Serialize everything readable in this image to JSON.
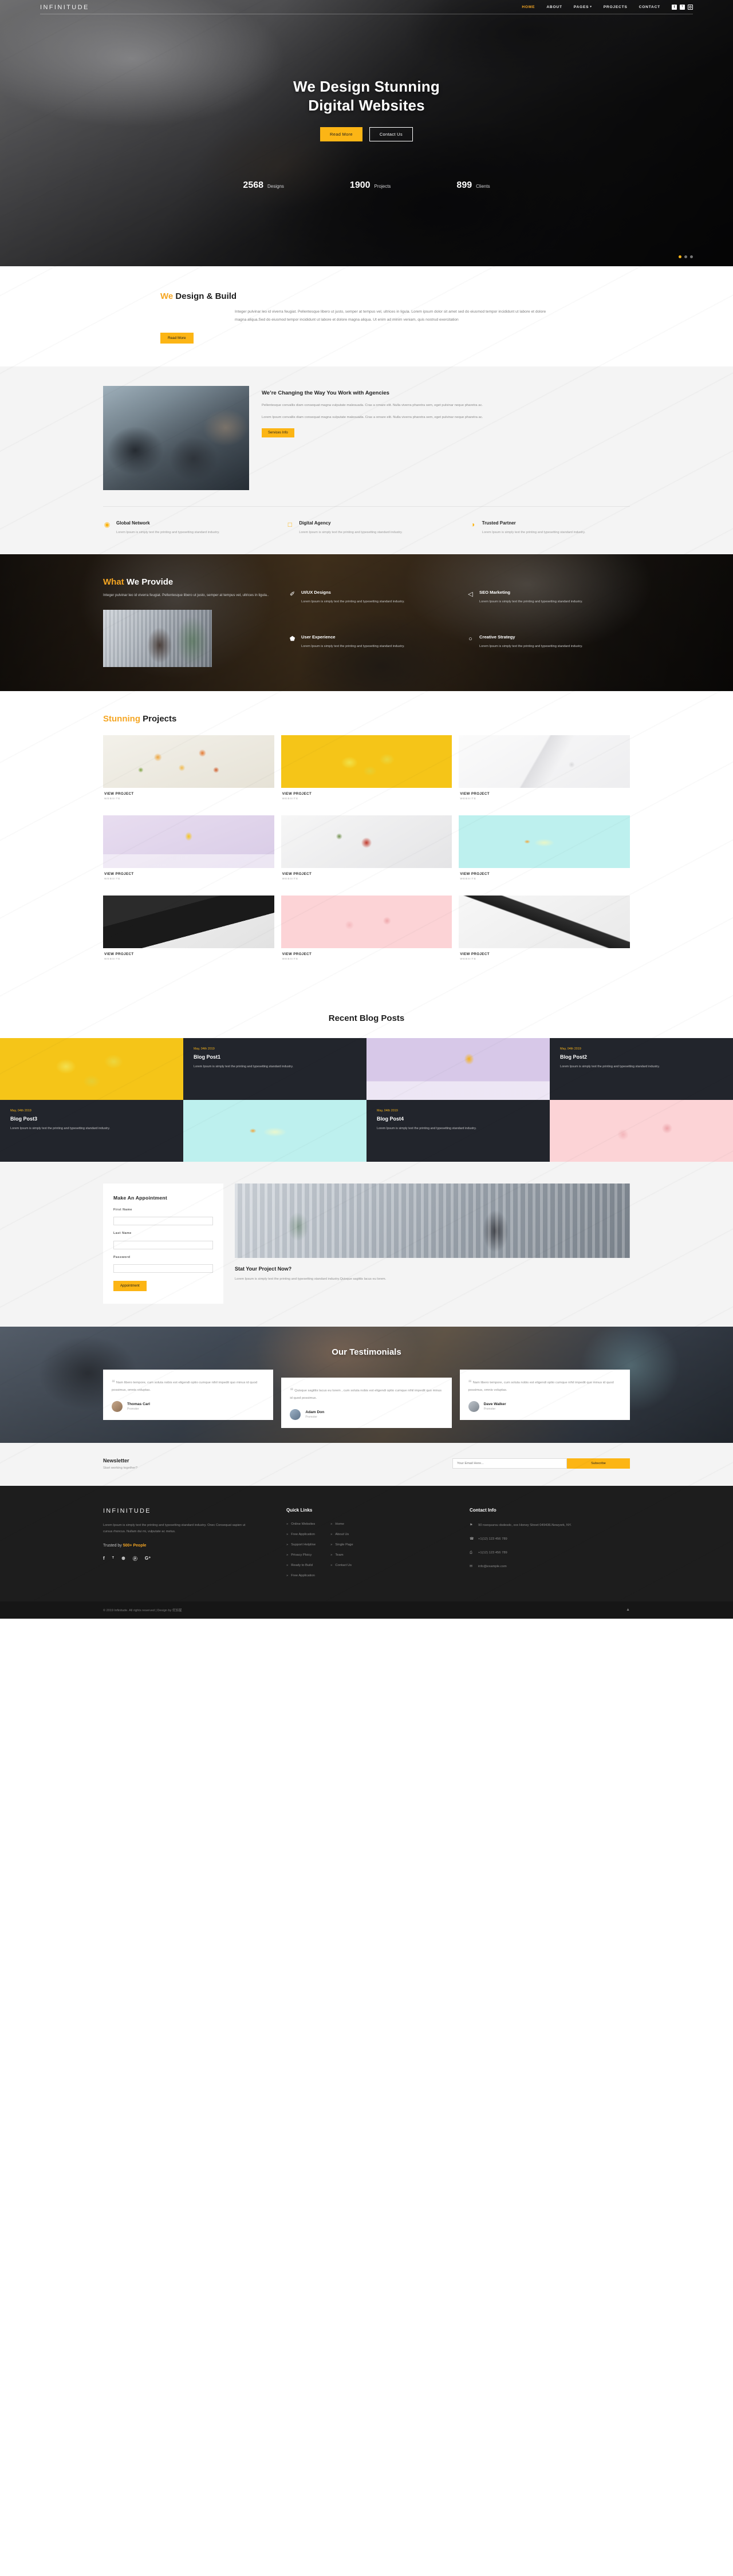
{
  "brand": "INFINITUDE",
  "nav": {
    "items": [
      {
        "label": "HOME",
        "active": true
      },
      {
        "label": "ABOUT",
        "active": false
      },
      {
        "label": "PAGES",
        "active": false,
        "caret": true
      },
      {
        "label": "PROJECTS",
        "active": false
      },
      {
        "label": "CONTACT",
        "active": false
      }
    ],
    "social": [
      {
        "name": "facebook-icon",
        "glyph": "f"
      },
      {
        "name": "twitter-icon",
        "glyph": "ᵀ"
      },
      {
        "name": "instagram-icon",
        "glyph": "◎"
      }
    ]
  },
  "hero": {
    "title_line1": "We Design Stunning",
    "title_line2": "Digital Websites",
    "primary_button": "Read More",
    "secondary_button": "Contact Us",
    "stats": [
      {
        "number": "2568",
        "label": "Designs"
      },
      {
        "number": "1900",
        "label": "Projects"
      },
      {
        "number": "899",
        "label": "Clients"
      }
    ]
  },
  "design_build": {
    "title_accent": "We",
    "title_rest": " Design & Build",
    "body": "Integer pulvinar leo id viverra feugiat. Pellentesque libero ut justo, semper at tempus vel, ultrices in ligula. Lorem ipsum dolor sit amet sed do eiusmod tempor incididunt ut labore et dolore magna aliqua.Sed do eiusmod tempor incididunt ut labore et dolore magna aliqua. Ut enim ad minim veniam, quis nostrud exercitation",
    "button": "Read More"
  },
  "agencies": {
    "title": "We’re Changing the Way You Work with Agencies",
    "para1": "Pellentesque convallis diam consequat magna vulputate malesuada. Cras a ornare elit. Nulla viverra pharetra sem, eget pulvinar neque pharetra ac.",
    "para2": "Lorem Ipsum convallis diam consequat magna vulputate malesuada. Cras a ornare elit. Nulla viverra pharetra sem, eget pulvinar neque pharetra ac.",
    "button": "Services Info",
    "features": [
      {
        "icon": "globe-icon",
        "glyph": "◉",
        "title": "Global Network",
        "text": "Lorem Ipsum is simply text the printing and typesetting standard industry."
      },
      {
        "icon": "monitor-icon",
        "glyph": "□",
        "title": "Digital Agency",
        "text": "Lorem Ipsum is simply text the printing and typesetting standard industry."
      },
      {
        "icon": "handshake-icon",
        "glyph": "◑",
        "title": "Trusted Partner",
        "text": "Lorem Ipsum is simply text the printing and typesetting standard industry."
      }
    ]
  },
  "provide": {
    "title_accent": "What",
    "title_rest": " We Provide",
    "body": "Integer pulvinar leo id viverra feugiat. Pellentesque libero ut justo, semper at tempus vel, ultrices in ligula..",
    "services": [
      {
        "icon": "brush-icon",
        "glyph": "✐",
        "title": "UI/UX Designs",
        "text": "Lorem Ipsum is simply text the printing and typesetting standard industry."
      },
      {
        "icon": "megaphone-icon",
        "glyph": "◁",
        "title": "SEO Marketing",
        "text": "Lorem Ipsum is simply text the printing and typesetting standard industry."
      },
      {
        "icon": "shield-icon",
        "glyph": "⬟",
        "title": "User Experience",
        "text": "Lorem Ipsum is simply text the printing and typesetting standard industry."
      },
      {
        "icon": "lightbulb-icon",
        "glyph": "○",
        "title": "Creative Strategy",
        "text": "Lorem Ipsum is simply text the printing and typesetting standard industry."
      }
    ]
  },
  "projects": {
    "title_accent": "Stunning",
    "title_rest": " Projects",
    "items": [
      {
        "thumb": "th1",
        "title": "VIEW PROJECT",
        "sub": "WEBSITE"
      },
      {
        "thumb": "th2",
        "title": "VIEW PROJECT",
        "sub": "WEBSITE"
      },
      {
        "thumb": "th3",
        "title": "VIEW PROJECT",
        "sub": "WEBSITE"
      },
      {
        "thumb": "th4",
        "title": "VIEW PROJECT",
        "sub": "WEBSITE"
      },
      {
        "thumb": "th5",
        "title": "VIEW PROJECT",
        "sub": "WEBSITE"
      },
      {
        "thumb": "th6",
        "title": "VIEW PROJECT",
        "sub": "WEBSITE"
      },
      {
        "thumb": "th7",
        "title": "VIEW PROJECT",
        "sub": "WEBSITE"
      },
      {
        "thumb": "th8",
        "title": "VIEW PROJECT",
        "sub": "WEBSITE"
      },
      {
        "thumb": "th9",
        "title": "VIEW PROJECT",
        "sub": "WEBSITE"
      }
    ]
  },
  "blog": {
    "title": "Recent Blog Posts",
    "posts": [
      {
        "date": "May, 04th 2019",
        "title": "Blog Post1",
        "excerpt": "Lorem Ipsum is simply text the printing and typesetting standard industry."
      },
      {
        "date": "May, 04th 2019",
        "title": "Blog Post2",
        "excerpt": "Lorem Ipsum is simply text the printing and typesetting standard industry."
      },
      {
        "date": "May, 04th 2019",
        "title": "Blog Post3",
        "excerpt": "Lorem Ipsum is simply text the printing and typesetting standard industry."
      },
      {
        "date": "May, 04th 2019",
        "title": "Blog Post4",
        "excerpt": "Lorem Ipsum is simply text the printing and typesetting standard industry."
      }
    ]
  },
  "appointment": {
    "title": "Make An Appointment",
    "first_name_label": "First Name",
    "first_name_value": "",
    "last_name_label": "Last Name",
    "last_name_value": "",
    "password_label": "Password",
    "password_value": "",
    "button": "Appointment",
    "right_title": "Stat Your Project Now?",
    "right_text": "Lorem Ipsum is simply text the printing and typesetting standard industry.Quisque sagittis lacus eu lorem."
  },
  "testimonials": {
    "title": "Our Testimonials",
    "items": [
      {
        "quote": "Nam libero tempore, cum soluta nobis est eligendi optio cumque nihil impedit quo minus id quod possimus, omnis voluptas.",
        "name": "Thomas Carl",
        "role": "Promoter"
      },
      {
        "quote": "Quisque sagittis lacus eu lorem , cum soluta nobis est eligendi optio cumque nihil impedit quo minus id quod possimus.",
        "name": "Adam Don",
        "role": "Promoter"
      },
      {
        "quote": "Nam libero tempore, cum soluta nobis est eligendi optio cumque nihil impedit quo minus id quod possimus, omnis voluptas.",
        "name": "Dave Walker",
        "role": "Promoter"
      }
    ]
  },
  "newsletter": {
    "title": "Newsletter",
    "subtitle": "Start working together?",
    "placeholder": "Your Email Here...",
    "value": "",
    "button": "Subscribe"
  },
  "footer": {
    "brand": "INFINITUDE",
    "about": "Lorem Ipsum is simply text the printing and typesetting standard industry. Onec Consequat sapien ut cursus rhoncus. Nullam dui mi, vulputate ac metus.",
    "trust_prefix": "Trusted by ",
    "trust_highlight": "500+ People",
    "social": [
      {
        "name": "facebook-icon",
        "glyph": "f"
      },
      {
        "name": "twitter-icon",
        "glyph": "ᵀ"
      },
      {
        "name": "dribbble-icon",
        "glyph": "⊛"
      },
      {
        "name": "pinterest-icon",
        "glyph": "ⓟ"
      },
      {
        "name": "google-plus-icon",
        "glyph": "G⁺"
      }
    ],
    "quick_links_title": "Quick Links",
    "quick_links_col1": [
      "Online Websites",
      "Free Application",
      "Support Helpline",
      "Privacy Ploicy",
      "Ready to Build",
      "Free Application"
    ],
    "quick_links_col2": [
      "Home",
      "About Us",
      "Single Page",
      "Team",
      "Contact Us"
    ],
    "contact_title": "Contact Info",
    "contact": [
      {
        "icon": "location-pin-icon",
        "glyph": "⚑",
        "text": "90 nsequursu dsdesdc, xxx Honey Street 049436.Newyork, NY."
      },
      {
        "icon": "phone-icon",
        "glyph": "☎",
        "text": "+1(12) 123 456 789"
      },
      {
        "icon": "fax-icon",
        "glyph": "⎙",
        "text": "+1(12) 123 456 789"
      },
      {
        "icon": "email-icon",
        "glyph": "✉",
        "text": "info@example.com"
      }
    ],
    "copyright": "© 2019 Infinitude. All rights reserved | Design by 优加星",
    "back_to_top": "▲"
  },
  "colors": {
    "accent": "#f5a623",
    "accent_button": "#fcb515",
    "dark": "#1d1d1d",
    "blog_card": "#22252c"
  }
}
